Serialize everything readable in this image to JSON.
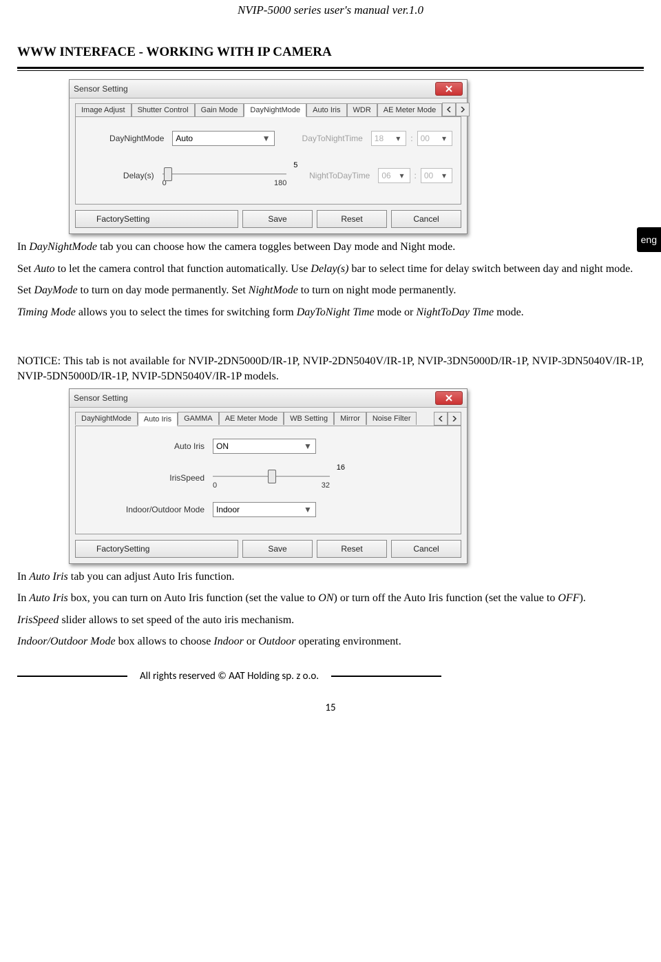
{
  "doc": {
    "header": "NVIP-5000 series  user's manual ver.1.0",
    "section": "WWW INTERFACE - WORKING WITH IP CAMERA",
    "lang_tag": "eng",
    "footer": "All rights reserved © AAT Holding sp. z o.o.",
    "page_num": "15"
  },
  "ss1": {
    "title": "Sensor Setting",
    "tabs": [
      "Image Adjust",
      "Shutter Control",
      "Gain Mode",
      "DayNightMode",
      "Auto Iris",
      "WDR",
      "AE Meter Mode"
    ],
    "active_tab": 3,
    "mode_label": "DayNightMode",
    "mode_value": "Auto",
    "d2n_label": "DayToNightTime",
    "d2n_hh": "18",
    "d2n_mm": "00",
    "n2d_label": "NightToDayTime",
    "n2d_hh": "06",
    "n2d_mm": "00",
    "delay_label": "Delay(s)",
    "delay_min": "0",
    "delay_max": "180",
    "delay_val": "5",
    "btn_factory": "FactorySetting",
    "btn_save": "Save",
    "btn_reset": "Reset",
    "btn_cancel": "Cancel"
  },
  "text1": {
    "p1a": "In ",
    "p1b": "DayNightMode",
    "p1c": " tab you can choose how the camera toggles between Day mode and Night mode.",
    "p2a": "Set ",
    "p2b": "Auto",
    "p2c": " to let the camera control that function automatically. Use ",
    "p2d": "Delay(s)",
    "p2e": " bar to select time for delay switch between day and night mode.",
    "p3a": "Set ",
    "p3b": "DayMode",
    "p3c": " to turn on day mode permanently. Set ",
    "p3d": "NightMode",
    "p3e": " to turn on night mode permanently.",
    "p4a": "Timing Mode",
    "p4b": " allows you to select the times for switching form ",
    "p4c": "DayToNight Time",
    "p4d": " mode or ",
    "p4e": "NightToDay Time",
    "p4f": " mode."
  },
  "notice": "NOTICE: This tab is not available for NVIP-2DN5000D/IR-1P, NVIP-2DN5040V/IR-1P, NVIP-3DN5000D/IR-1P, NVIP-3DN5040V/IR-1P, NVIP-5DN5000D/IR-1P, NVIP-5DN5040V/IR-1P models.",
  "ss2": {
    "title": "Sensor Setting",
    "tabs": [
      "DayNightMode",
      "Auto Iris",
      "GAMMA",
      "AE Meter Mode",
      "WB Setting",
      "Mirror",
      "Noise Filter"
    ],
    "active_tab": 1,
    "ai_label": "Auto Iris",
    "ai_value": "ON",
    "speed_label": "IrisSpeed",
    "speed_min": "0",
    "speed_max": "32",
    "speed_val": "16",
    "io_label": "Indoor/Outdoor Mode",
    "io_value": "Indoor",
    "btn_factory": "FactorySetting",
    "btn_save": "Save",
    "btn_reset": "Reset",
    "btn_cancel": "Cancel"
  },
  "text2": {
    "p1a": "In ",
    "p1b": "Auto Iris",
    "p1c": " tab you can adjust Auto Iris function.",
    "p2a": "In ",
    "p2b": "Auto Iris",
    "p2c": " box, you can turn on Auto Iris function (set the value to ",
    "p2d": "ON",
    "p2e": ") or turn off the Auto Iris function (set the value to ",
    "p2f": "OFF",
    "p2g": ").",
    "p3a": "IrisSpeed",
    "p3b": "  slider allows to set speed of the auto iris mechanism.",
    "p4a": "Indoor/Outdoor Mode",
    "p4b": " box allows to choose ",
    "p4c": "Indoor",
    "p4d": " or ",
    "p4e": "Outdoor",
    "p4f": " operating environment."
  }
}
